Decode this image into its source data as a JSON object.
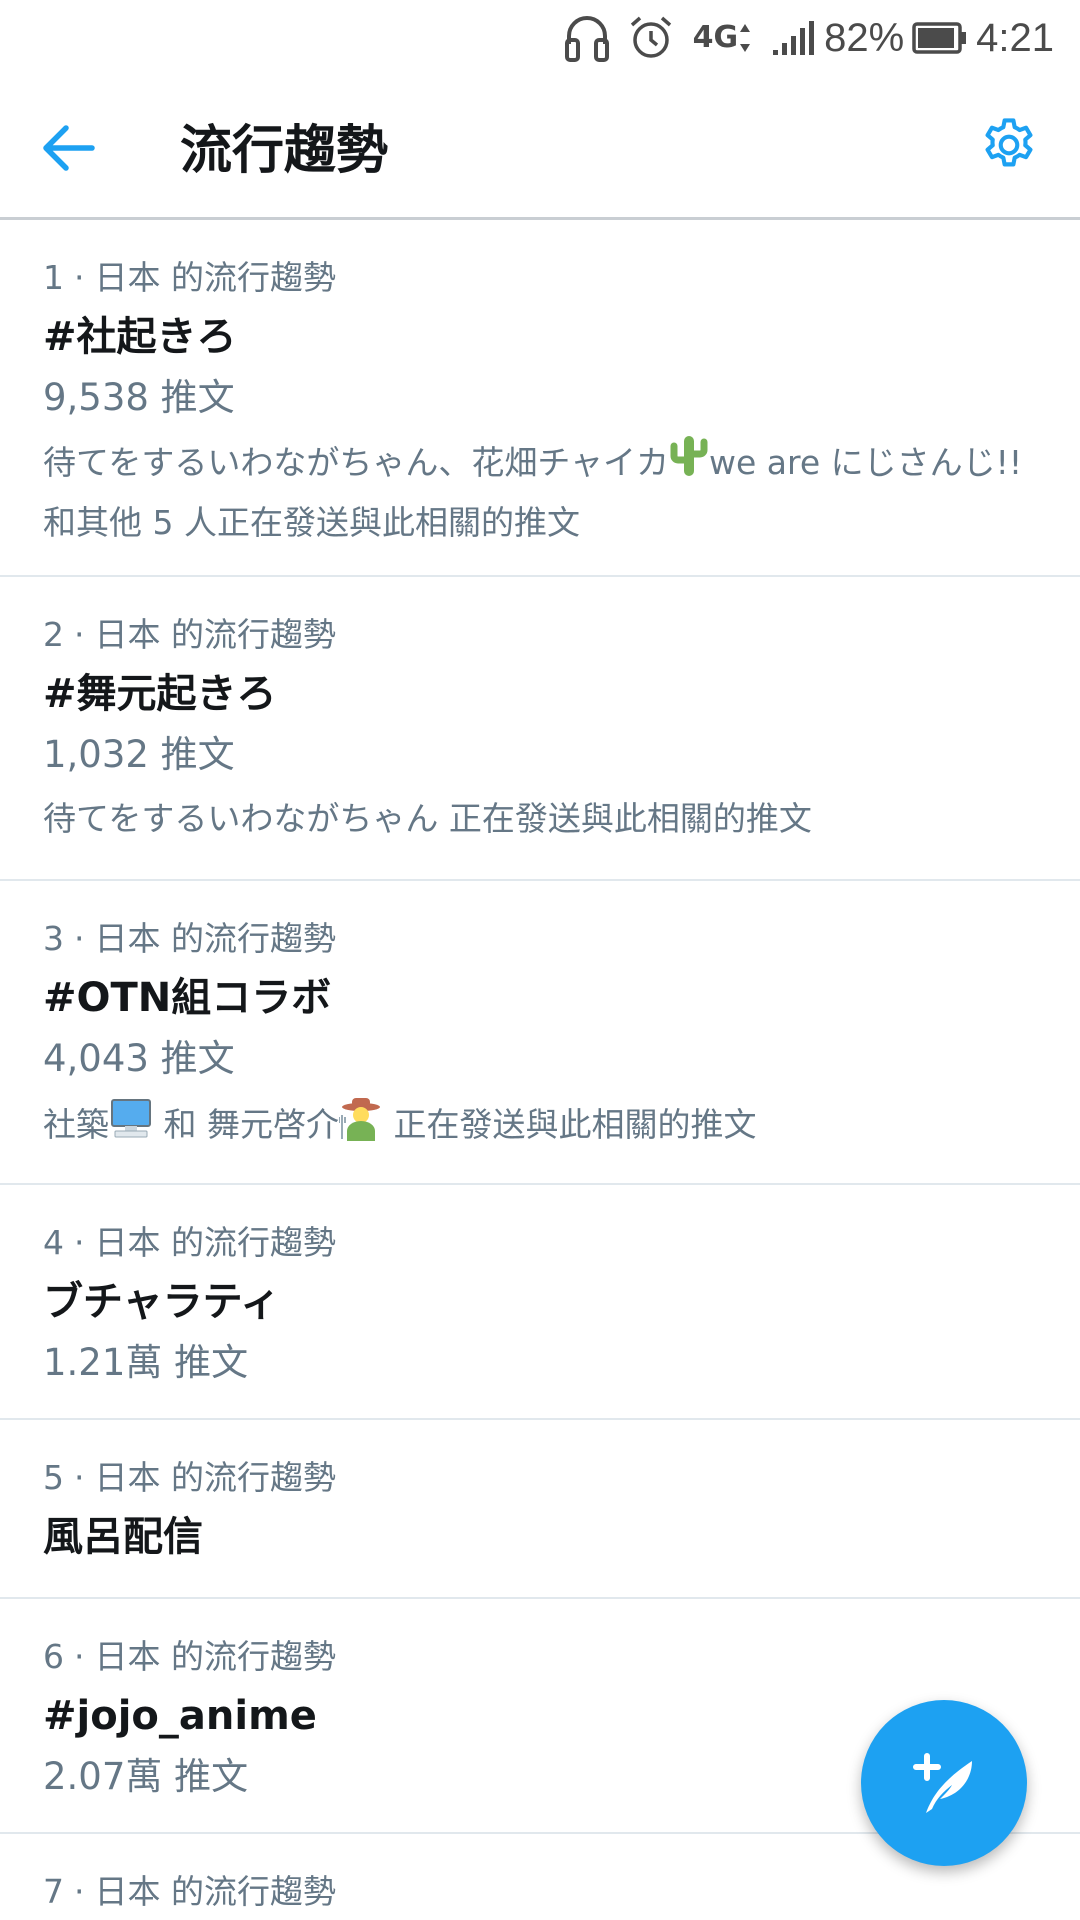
{
  "status_bar": {
    "network": "4G",
    "battery_percent": "82%",
    "time": "4:21",
    "icons": [
      "headphones-icon",
      "alarm-icon",
      "network-4g-icon",
      "signal-icon",
      "battery-icon"
    ]
  },
  "header": {
    "title": "流行趨勢",
    "back_icon": "arrow-left-icon",
    "settings_icon": "gear-icon"
  },
  "colors": {
    "accent": "#1da1f2",
    "primary_text": "#14171a",
    "secondary_text": "#657786",
    "divider": "#e1e8ed"
  },
  "trends": [
    {
      "rank": "1",
      "separator": "·",
      "context": "日本 的流行趨勢",
      "name": "#社起きろ",
      "count": "9,538 推文",
      "desc_part1": "待てをするいわながちゃん、花畑チャイカ",
      "desc_part2": "we are にじさんじ!! 和其他 5 人正在發送與此相關的推文",
      "emoji_icons": [
        "cactus-icon"
      ]
    },
    {
      "rank": "2",
      "separator": "·",
      "context": "日本 的流行趨勢",
      "name": "#舞元起きろ",
      "count": "1,032 推文",
      "desc": "待てをするいわながちゃん 正在發送與此相關的推文"
    },
    {
      "rank": "3",
      "separator": "·",
      "context": "日本 的流行趨勢",
      "name": "#OTN組コラボ",
      "count": "4,043 推文",
      "desc_part1": "社築",
      "desc_part2": " 和 舞元啓介",
      "desc_part3": " 正在發送與此相關的推文",
      "emoji_icons": [
        "computer-icon",
        "farmer-icon"
      ]
    },
    {
      "rank": "4",
      "separator": "·",
      "context": "日本 的流行趨勢",
      "name": "ブチャラティ",
      "count": "1.21萬 推文"
    },
    {
      "rank": "5",
      "separator": "·",
      "context": "日本 的流行趨勢",
      "name": "風呂配信"
    },
    {
      "rank": "6",
      "separator": "·",
      "context": "日本 的流行趨勢",
      "name": "#jojo_anime",
      "count": "2.07萬 推文"
    },
    {
      "rank": "7",
      "separator": "·",
      "context": "日本 的流行趨勢"
    }
  ],
  "fab": {
    "icon": "compose-tweet-icon"
  }
}
